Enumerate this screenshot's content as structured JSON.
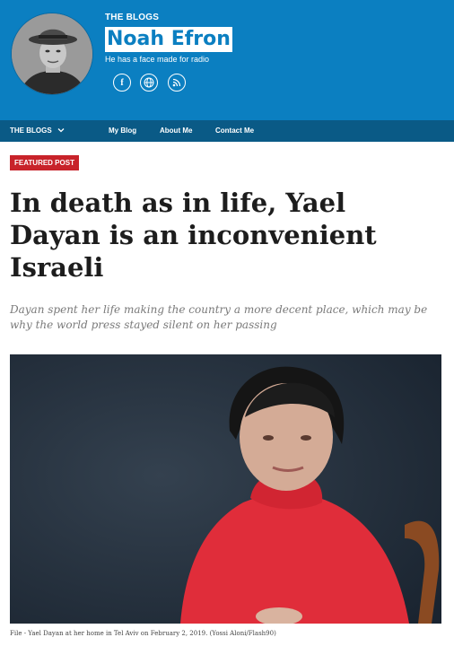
{
  "header": {
    "section_label": "THE BLOGS",
    "author_name": "Noah Efron",
    "tagline": "He has a face made for radio",
    "social": [
      {
        "icon": "facebook-icon",
        "glyph": "f"
      },
      {
        "icon": "globe-icon"
      },
      {
        "icon": "rss-icon"
      }
    ],
    "colors": {
      "brand": "#0b7fc1",
      "nav": "#0a5a86"
    }
  },
  "nav": {
    "items": [
      {
        "label": "THE BLOGS"
      },
      {
        "label": "My Blog"
      },
      {
        "label": "About Me"
      },
      {
        "label": "Contact Me"
      }
    ]
  },
  "article": {
    "badge": "FEATURED POST",
    "badge_color": "#c8232a",
    "headline": "In death as in life, Yael Dayan is an inconvenient Israeli",
    "subhead": "Dayan spent her life making the country a more decent place, which may be why the world press stayed silent on her passing",
    "caption": "File - Yael Dayan at her home in Tel Aviv on February 2, 2019. (Yossi Aloni/Flash90)"
  }
}
